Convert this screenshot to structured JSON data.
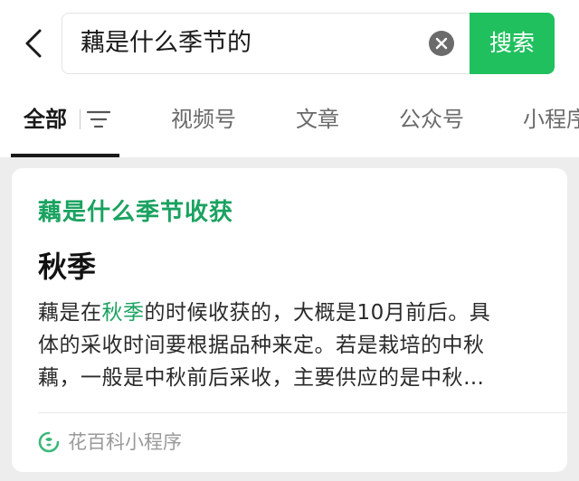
{
  "search": {
    "query": "藕是什么季节的",
    "button_label": "搜索"
  },
  "tabs": [
    {
      "label": "全部"
    },
    {
      "label": "视频号"
    },
    {
      "label": "文章"
    },
    {
      "label": "公众号"
    },
    {
      "label": "小程序"
    }
  ],
  "result": {
    "title": "藕是什么季节收获",
    "answer": "秋季",
    "snippet_pre": "藕是在",
    "snippet_highlight": "秋季",
    "snippet_line1_rest": "的时候收获的，大概是10月前后。具",
    "snippet_line2": "体的采收时间要根据品种来定。若是栽培的中秋",
    "snippet_line3": "藕，一般是中秋前后采收，主要供应的是中秋…",
    "source": "花百科小程序"
  },
  "colors": {
    "accent": "#21c05f",
    "highlight": "#1aa260"
  },
  "icons": {
    "back": "chevron-left-icon",
    "clear": "clear-circle-icon",
    "filter": "filter-lines-icon",
    "source": "mini-program-icon"
  }
}
